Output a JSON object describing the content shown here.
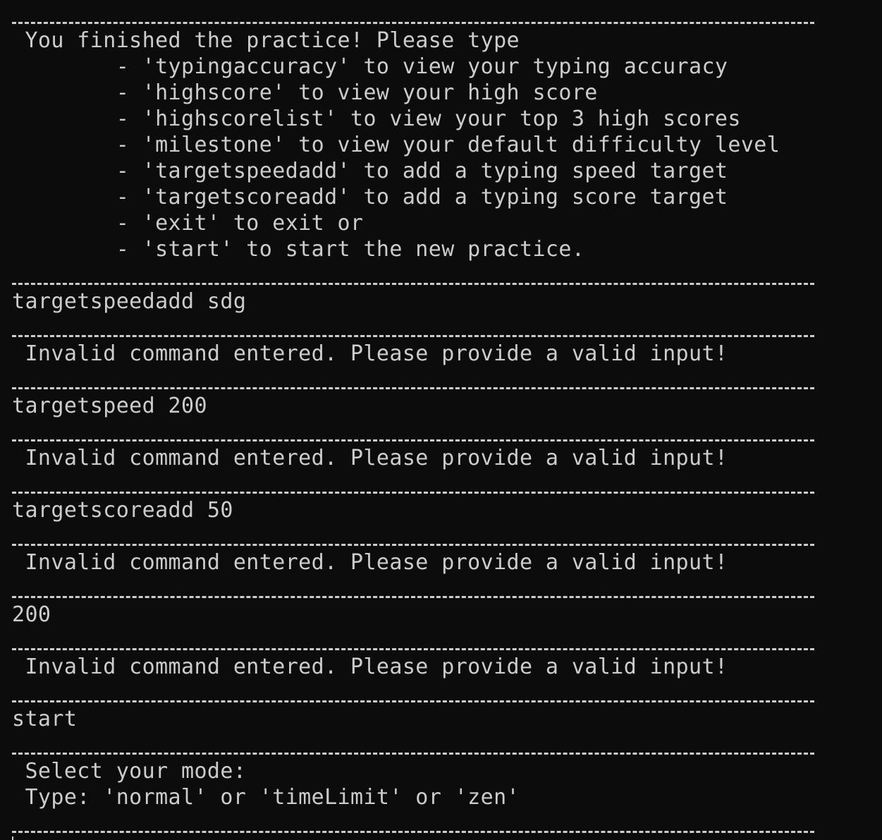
{
  "terminal": {
    "menu": {
      "header": " You finished the practice! Please type",
      "options": [
        "        - 'typingaccuracy' to view your typing accuracy",
        "        - 'highscore' to view your high score",
        "        - 'highscorelist' to view your top 3 high scores",
        "        - 'milestone' to view your default difficulty level",
        "        - 'targetspeedadd' to add a typing speed target",
        "        - 'targetscoreadd' to add a typing score target",
        "        - 'exit' to exit or",
        "        - 'start' to start the new practice."
      ]
    },
    "exchanges": [
      {
        "input": "targetspeedadd sdg",
        "response": " Invalid command entered. Please provide a valid input!"
      },
      {
        "input": "targetspeed 200",
        "response": " Invalid command entered. Please provide a valid input!"
      },
      {
        "input": "targetscoreadd 50",
        "response": " Invalid command entered. Please provide a valid input!"
      },
      {
        "input": "200",
        "response": " Invalid command entered. Please provide a valid input!"
      }
    ],
    "final_input": "start",
    "mode_prompt": {
      "line1": " Select your mode:",
      "line2": " Type: 'normal' or 'timeLimit' or 'zen'"
    },
    "colors": {
      "background": "#0c0c0c",
      "text": "#cccccc"
    }
  }
}
